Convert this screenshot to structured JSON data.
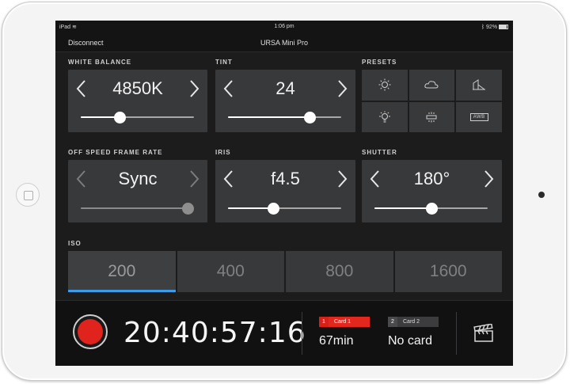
{
  "status": {
    "device": "iPad",
    "time": "1:06 pm",
    "battery": "92%"
  },
  "nav": {
    "disconnect": "Disconnect",
    "title": "URSA Mini Pro"
  },
  "white_balance": {
    "label": "WHITE BALANCE",
    "value": "4850K",
    "slider_fraction": 0.34
  },
  "tint": {
    "label": "TINT",
    "value": "24",
    "slider_fraction": 0.72
  },
  "presets": {
    "label": "PRESETS",
    "items": [
      {
        "icon": "sun-icon"
      },
      {
        "icon": "cloud-icon"
      },
      {
        "icon": "shade-icon"
      },
      {
        "icon": "bulb-icon"
      },
      {
        "icon": "fluorescent-icon"
      },
      {
        "icon": "awb-icon",
        "text": "AWB"
      }
    ]
  },
  "frame_rate": {
    "label": "OFF SPEED FRAME RATE",
    "value": "Sync",
    "slider_fraction": 1.0
  },
  "iris": {
    "label": "IRIS",
    "value": "f4.5",
    "slider_fraction": 0.4
  },
  "shutter": {
    "label": "SHUTTER",
    "value": "180°",
    "slider_fraction": 0.5
  },
  "iso": {
    "label": "ISO",
    "options": [
      "200",
      "400",
      "800",
      "1600"
    ],
    "selected": "200"
  },
  "record": {
    "timecode": "20:40:57:16",
    "card1": {
      "num": "1",
      "name": "Card 1",
      "info": "67min"
    },
    "card2": {
      "num": "2",
      "name": "Card 2",
      "info": "No card"
    }
  },
  "colors": {
    "accent_blue": "#3d9be9",
    "record_red": "#e0231c",
    "panel": "#38393b"
  }
}
